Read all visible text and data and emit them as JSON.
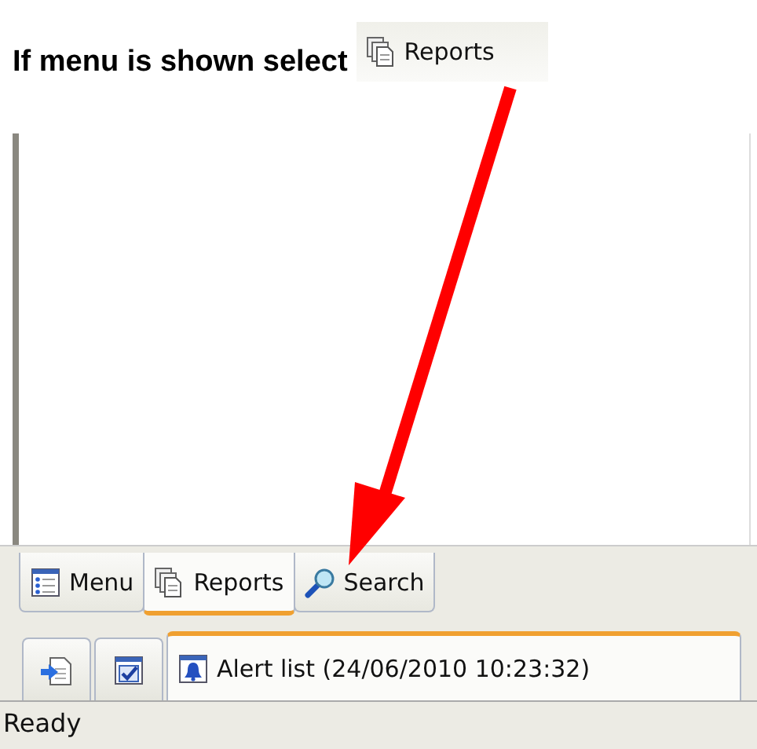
{
  "instruction": {
    "text": "If menu is shown select",
    "callout_label": "Reports"
  },
  "view_tabs": [
    {
      "label": "Menu",
      "selected": false
    },
    {
      "label": "Reports",
      "selected": true
    },
    {
      "label": "Search",
      "selected": false
    }
  ],
  "document_tabs": [
    {
      "kind": "icon",
      "selected": false
    },
    {
      "kind": "icon",
      "selected": false
    },
    {
      "kind": "labeled",
      "label": "Alert list (24/06/2010 10:23:32)",
      "selected": true
    }
  ],
  "status_bar": {
    "text": "Ready"
  }
}
